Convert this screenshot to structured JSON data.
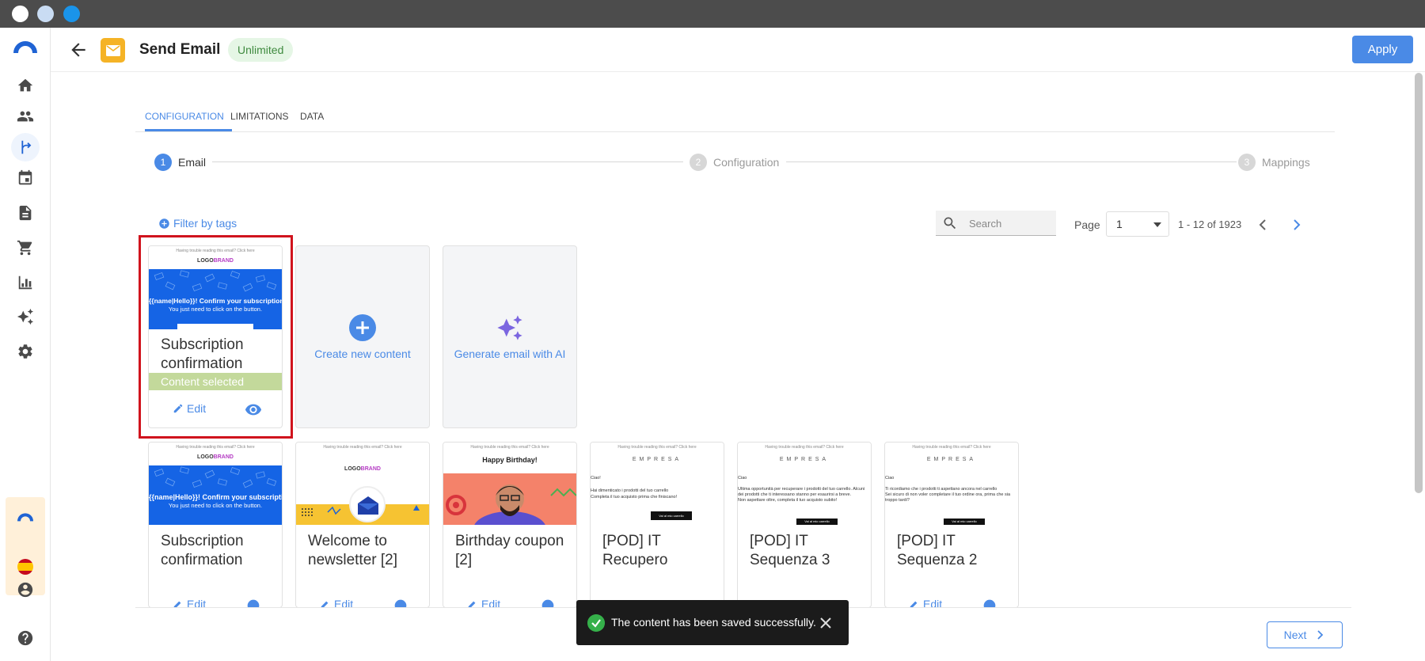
{
  "header": {
    "title": "Send Email",
    "badge": "Unlimited",
    "apply_label": "Apply"
  },
  "sidebar": {
    "items": [
      {
        "icon": "home-icon"
      },
      {
        "icon": "users-icon"
      },
      {
        "icon": "flow-icon",
        "active": true
      },
      {
        "icon": "calendar-icon"
      },
      {
        "icon": "document-icon"
      },
      {
        "icon": "cart-icon"
      },
      {
        "icon": "chart-icon"
      },
      {
        "icon": "ai-sparkle-icon"
      },
      {
        "icon": "gear-icon"
      }
    ],
    "bottom": [
      {
        "icon": "account-icon"
      },
      {
        "icon": "help-icon"
      }
    ]
  },
  "tabs": [
    {
      "label": "CONFIGURATION",
      "active": true
    },
    {
      "label": "LIMITATIONS"
    },
    {
      "label": "DATA"
    }
  ],
  "stepper": [
    {
      "num": "1",
      "label": "Email",
      "active": true
    },
    {
      "num": "2",
      "label": "Configuration"
    },
    {
      "num": "3",
      "label": "Mappings"
    }
  ],
  "filter_label": "Filter by tags",
  "search": {
    "placeholder": "Search"
  },
  "pagination": {
    "page_label": "Page",
    "page_value": "1",
    "range": "1 - 12 of 1923"
  },
  "actions": {
    "create": "Create new content",
    "generate": "Generate email with AI"
  },
  "selected_card": {
    "name": "Subscription confirmation",
    "status": "Content selected",
    "edit_label": "Edit",
    "thumb": {
      "header": "Having trouble reading this email? Click here",
      "logo_a": "LOGO",
      "logo_b": "BRAND",
      "line1": "{{name|Hello}}! Confirm your subscription",
      "line2": "You just need to click on the button."
    }
  },
  "cards": [
    {
      "name": "Subscription confirmation",
      "edit_label": "Edit"
    },
    {
      "name": "Welcome to newsletter [2]",
      "edit_label": "Edit"
    },
    {
      "name": "Birthday coupon [2]",
      "edit_label": "Edit"
    },
    {
      "name": "[POD] IT Recupero",
      "edit_label": ""
    },
    {
      "name": "[POD] IT Sequenza 3",
      "edit_label": ""
    },
    {
      "name": "[POD] IT Sequenza 2",
      "edit_label": "Edit"
    }
  ],
  "thumbs": {
    "birthday_title": "Happy Birthday!",
    "empresa": "EMPRESA",
    "recupero_lines": [
      "Ciao!",
      "Hai dimenticato i prodotti del tuo carrello",
      "Completa il tuo acquisto prima che finiscano!"
    ],
    "sequenza3_lines": [
      "Ciao",
      "Ultima opportunità per recuperare i prodotti del tuo carrello. Alcuni",
      "dei prodotti che ti interessano stanno per esaurirsi a breve.",
      "Non aspettare oltre, completa il tuo acquisto subito!"
    ],
    "sequenza2_lines": [
      "Ciao",
      "Ti ricordiamo che i prodotti ti aspettano ancora nel carrello",
      "Sei sicuro di non voler completare il tuo ordine ora, prima che sia",
      "troppo tardi?"
    ],
    "cart_button": "Vai al mio carrello"
  },
  "toast": {
    "message": "The content has been saved successfully."
  },
  "next_label": "Next",
  "colors": {
    "accent": "#4a8ae6",
    "selection_border": "#d0131d",
    "badge_bg": "#e5f6e5",
    "content_selected": "#c3d99b",
    "app_badge": "#f5b326"
  }
}
